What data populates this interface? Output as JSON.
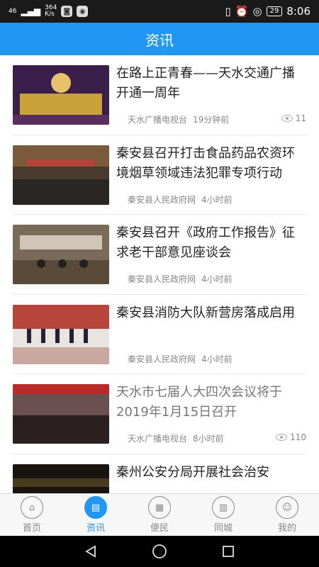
{
  "status_bar": {
    "signal": "46",
    "speed_value": "364",
    "speed_unit": "K/s",
    "battery": "29",
    "time": "8:06"
  },
  "header": {
    "title": "资讯"
  },
  "news": [
    {
      "title": "在路上正青春——天水交通广播开通一周年",
      "source": "天水广播电视台",
      "time": "19分钟前",
      "views": "11",
      "read": false
    },
    {
      "title": "秦安县召开打击食品药品农资环境烟草领域违法犯罪专项行动",
      "source": "秦安县人民政府网",
      "time": "4小时前",
      "views": "",
      "read": false
    },
    {
      "title": "秦安县召开《政府工作报告》征求老干部意见座谈会",
      "source": "秦安县人民政府网",
      "time": "4小时前",
      "views": "",
      "read": false
    },
    {
      "title": "秦安县消防大队新营房落成启用",
      "source": "秦安县人民政府网",
      "time": "4小时前",
      "views": "",
      "read": false
    },
    {
      "title": "天水市七届人大四次会议将于2019年1月15日召开",
      "source": "天水广播电视台",
      "time": "8小时前",
      "views": "110",
      "read": true
    },
    {
      "title": "秦州公安分局开展社会治安",
      "source": "",
      "time": "",
      "views": "",
      "read": false
    }
  ],
  "tabs": [
    {
      "label": "首页",
      "icon": "home-icon",
      "active": false
    },
    {
      "label": "资讯",
      "icon": "news-icon",
      "active": true
    },
    {
      "label": "便民",
      "icon": "grid-icon",
      "active": false
    },
    {
      "label": "同城",
      "icon": "city-icon",
      "active": false
    },
    {
      "label": "我的",
      "icon": "user-icon",
      "active": false
    }
  ],
  "colors": {
    "accent": "#2196f3",
    "status_bg": "#1a1a1a"
  }
}
